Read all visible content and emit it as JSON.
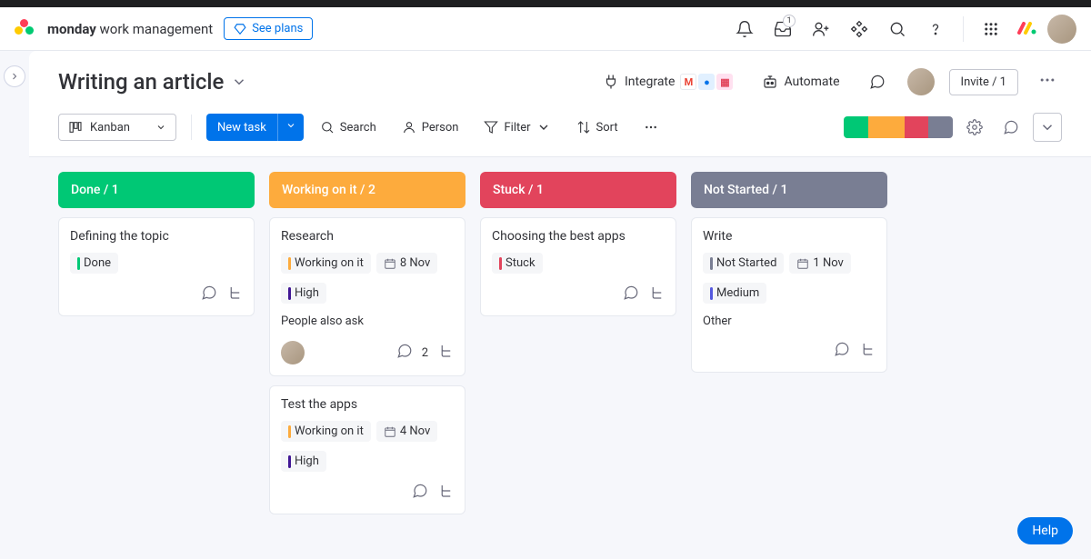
{
  "topbar": {
    "brand_bold": "monday",
    "brand_rest": " work management",
    "see_plans": "See plans",
    "inbox_badge": "1"
  },
  "board": {
    "title": "Writing an article",
    "integrate": "Integrate",
    "automate": "Automate",
    "invite": "Invite / 1"
  },
  "toolbar": {
    "view": "Kanban",
    "new_task": "New task",
    "search": "Search",
    "person": "Person",
    "filter": "Filter",
    "sort": "Sort"
  },
  "status_colors": {
    "done": "#00c875",
    "working": "#fdab3d",
    "stuck": "#e2445c",
    "not_started": "#797e93"
  },
  "priority_colors": {
    "high": "#401694",
    "medium": "#5559df"
  },
  "lanes": [
    {
      "id": "done",
      "title": "Done / 1",
      "color": "#00c875",
      "cards": [
        {
          "title": "Defining the topic",
          "status": {
            "label": "Done",
            "color": "#00c875"
          },
          "footer": {
            "avatar": false
          }
        }
      ]
    },
    {
      "id": "working",
      "title": "Working on it / 2",
      "color": "#fdab3d",
      "cards": [
        {
          "title": "Research",
          "status": {
            "label": "Working on it",
            "color": "#fdab3d"
          },
          "date": "8 Nov",
          "priority": {
            "label": "High",
            "color": "#401694"
          },
          "extra_text": "People also ask",
          "footer": {
            "avatar": true,
            "subitems": 2
          }
        },
        {
          "title": "Test the apps",
          "status": {
            "label": "Working on it",
            "color": "#fdab3d"
          },
          "date": "4 Nov",
          "priority": {
            "label": "High",
            "color": "#401694"
          },
          "footer": {
            "avatar": false
          }
        }
      ]
    },
    {
      "id": "stuck",
      "title": "Stuck / 1",
      "color": "#e2445c",
      "cards": [
        {
          "title": "Choosing the best apps",
          "status": {
            "label": "Stuck",
            "color": "#e2445c"
          },
          "footer": {
            "avatar": false
          }
        }
      ]
    },
    {
      "id": "not_started",
      "title": "Not Started / 1",
      "color": "#797e93",
      "cards": [
        {
          "title": "Write",
          "status": {
            "label": "Not Started",
            "color": "#797e93"
          },
          "date": "1 Nov",
          "priority": {
            "label": "Medium",
            "color": "#5559df"
          },
          "extra_text": "Other",
          "footer": {
            "avatar": false
          }
        }
      ]
    }
  ],
  "help": "Help"
}
